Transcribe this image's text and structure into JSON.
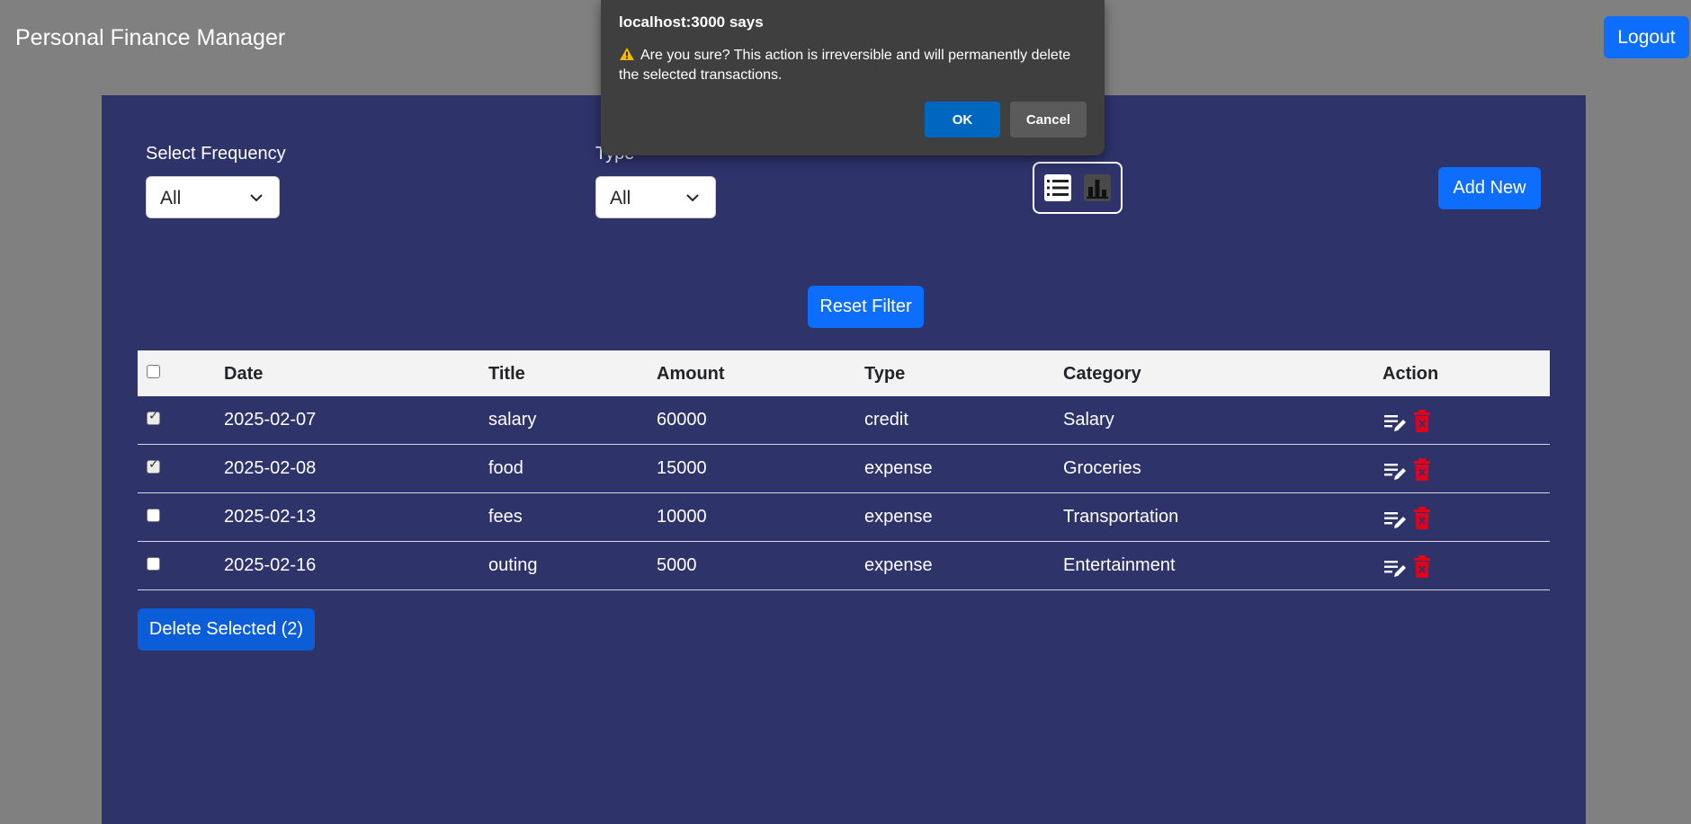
{
  "app": {
    "title": "Personal Finance Manager",
    "logout_label": "Logout"
  },
  "filters": {
    "frequency_label": "Select Frequency",
    "frequency_value": "All",
    "type_label": "Type",
    "type_value": "All",
    "view_mode": "list",
    "add_new_label": "Add New",
    "reset_label": "Reset Filter"
  },
  "table": {
    "headers": [
      "Date",
      "Title",
      "Amount",
      "Type",
      "Category",
      "Action"
    ],
    "rows": [
      {
        "checked": true,
        "date": "2025-02-07",
        "title": "salary",
        "amount": "60000",
        "type": "credit",
        "category": "Salary"
      },
      {
        "checked": true,
        "date": "2025-02-08",
        "title": "food",
        "amount": "15000",
        "type": "expense",
        "category": "Groceries"
      },
      {
        "checked": false,
        "date": "2025-02-13",
        "title": "fees",
        "amount": "10000",
        "type": "expense",
        "category": "Transportation"
      },
      {
        "checked": false,
        "date": "2025-02-16",
        "title": "outing",
        "amount": "5000",
        "type": "expense",
        "category": "Entertainment"
      }
    ]
  },
  "delete_selected_label": "Delete Selected (2)",
  "dialog": {
    "title": "localhost:3000 says",
    "message": "Are you sure? This action is irreversible and will permanently delete the selected transactions.",
    "ok_label": "OK",
    "cancel_label": "Cancel",
    "warning_icon": "warning-icon"
  },
  "colors": {
    "background": "#808080",
    "panel": "#2e336a",
    "primary": "#0d6efd",
    "delete_icon": "#e0001b",
    "dialog_bg": "#3f3f3f",
    "dialog_ok": "#0067c0"
  }
}
